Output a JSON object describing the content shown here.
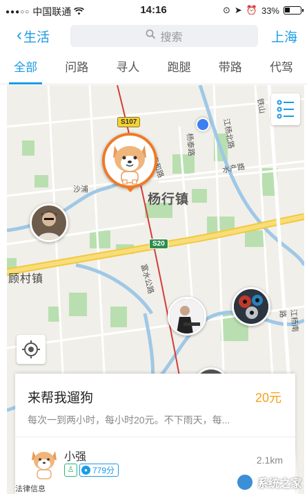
{
  "status_bar": {
    "carrier": "中国联通",
    "time": "14:16",
    "battery": "33%"
  },
  "nav": {
    "back_label": "生活",
    "search_placeholder": "搜索",
    "city": "上海"
  },
  "tabs": [
    {
      "label": "全部",
      "active": true
    },
    {
      "label": "问路",
      "active": false
    },
    {
      "label": "寻人",
      "active": false
    },
    {
      "label": "跑腿",
      "active": false
    },
    {
      "label": "带路",
      "active": false
    },
    {
      "label": "代驾",
      "active": false
    }
  ],
  "map": {
    "town_label": "杨行镇",
    "town_label_2": "顾村镇",
    "road_badges": [
      "S107",
      "S20"
    ],
    "road_labels": [
      "沙浦",
      "杨泰路",
      "江杨北路",
      "水产路",
      "泰和路",
      "铁山",
      "富水公路",
      "江杨南路"
    ],
    "bottom_place": "法律信息"
  },
  "card": {
    "title": "来帮我遛狗",
    "price": "20元",
    "description": "每次一到两小时，每小时20元。不下雨天，每...",
    "user_name": "小强",
    "score": "779分",
    "distance": "2.1km"
  },
  "watermark": "系统之家",
  "colors": {
    "accent": "#1a9be6",
    "price": "#f1a419",
    "dog_pin": "#f07a24"
  }
}
